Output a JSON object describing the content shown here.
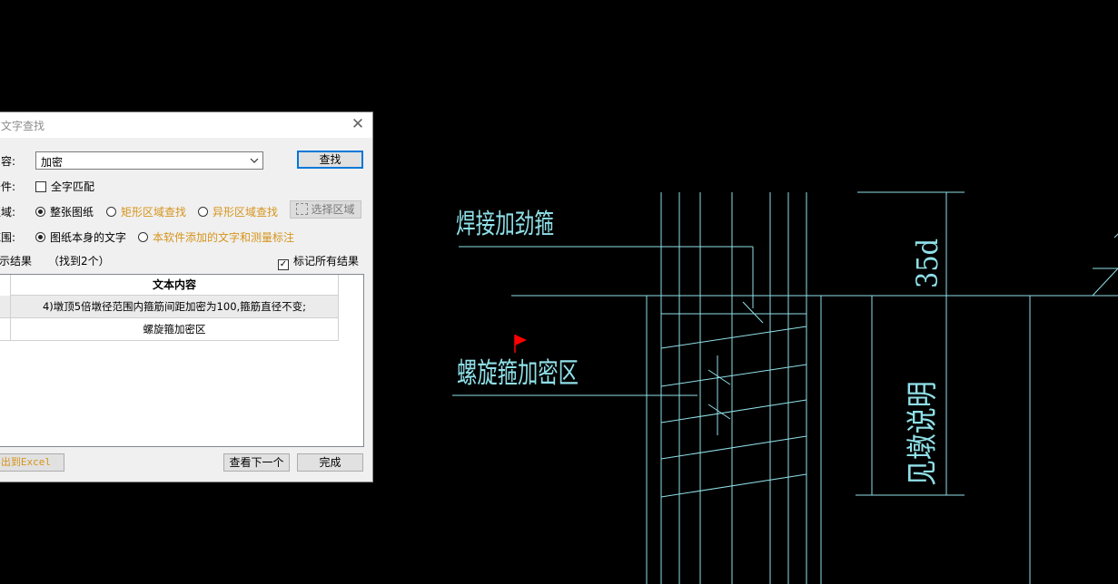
{
  "dialog": {
    "title": "文字查找",
    "close_glyph": "✕",
    "content_label": "内容:",
    "search_value": "加密",
    "find_button": "查找",
    "condition_label": "条件:",
    "whole_word_match": "全字匹配",
    "area_label": "区域:",
    "area_options": [
      "整张图纸",
      "矩形区域查找",
      "异形区域查找"
    ],
    "select_area_button": "选择区域",
    "scope_label": "范围:",
    "scope_options": [
      "图纸本身的文字",
      "本软件添加的文字和测量标注"
    ],
    "results_label": "显示结果",
    "results_count": "（找到2个）",
    "mark_all_label": "标记所有结果",
    "table": {
      "column_header": "文本内容",
      "rows": [
        "4)墩顶5倍墩径范围内箍筋间距加密为100,箍筋直径不变;",
        "螺旋箍加密区"
      ]
    },
    "export_button": "导出到Excel",
    "next_button": "查看下一个",
    "done_button": "完成"
  },
  "drawing": {
    "texts": [
      "焊接加劲箍",
      "螺旋箍加密区",
      "35d",
      "见墩说明"
    ],
    "line_color": "#8fe0e8",
    "flag_color": "#ff0000"
  }
}
